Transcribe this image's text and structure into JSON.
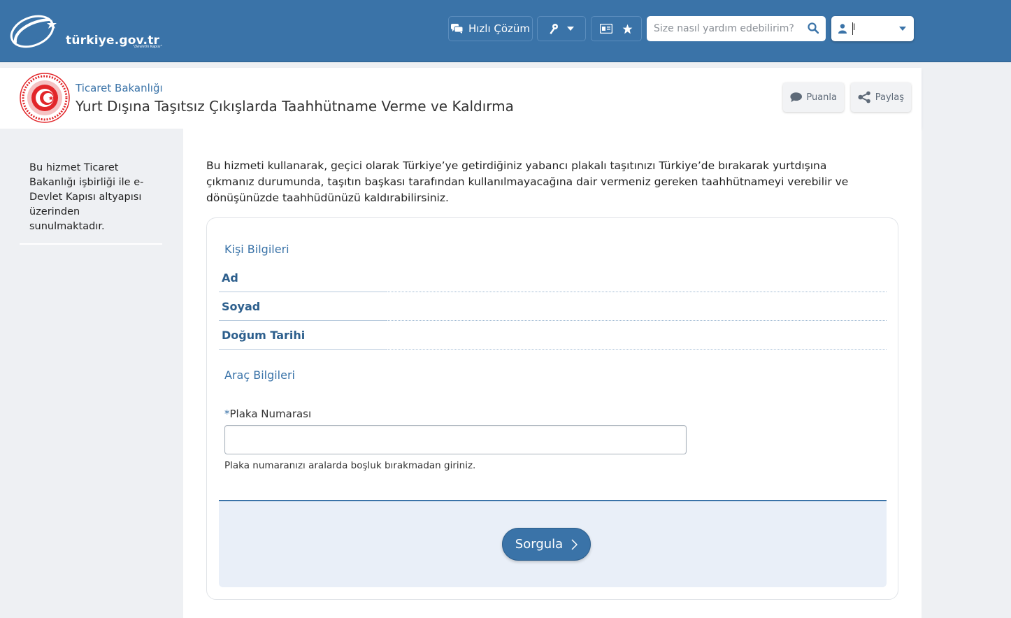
{
  "header": {
    "logo_text": "türkiye.gov.tr",
    "logo_sub": "\"Devletin Kapısı\"",
    "quick_solution_label": "Hızlı Çözüm",
    "search_placeholder": "Size nasıl yardım edebilirim?",
    "user_name": "l"
  },
  "service": {
    "ministry": "Ticaret Bakanlığı",
    "title": "Yurt Dışına Taşıtsız Çıkışlarda Taahhütname Verme ve Kaldırma",
    "rate_label": "Puanla",
    "share_label": "Paylaş"
  },
  "sidebar": {
    "info_text": "Bu hizmet Ticaret Bakanlığı işbirliği ile e-Devlet Kapısı altyapısı üzerinden sunulmaktadır."
  },
  "main": {
    "intro": "Bu hizmeti kullanarak, geçici olarak Türkiye’ye getirdiğiniz yabancı plakalı taşıtınızı Türkiye’de bırakarak yurtdışına çıkmanız durumunda, taşıtın başkası tarafından kullanılmayacağına dair vermeniz gereken taahhütnameyi verebilir ve dönüşünüzde taahhüdünüzü kaldırabilirsiniz.",
    "person_section_title": "Kişi Bilgileri",
    "person_fields": [
      "Ad",
      "Soyad",
      "Doğum Tarihi"
    ],
    "vehicle_section_title": "Araç Bilgileri",
    "plate_required_mark": "*",
    "plate_label": "Plaka Numarası",
    "plate_value": "",
    "plate_help": "Plaka numaranızı aralarda boşluk bırakmadan giriniz.",
    "submit_label": "Sorgula"
  },
  "colors": {
    "brand_blue": "#3a73a8",
    "background": "#eef0f3",
    "submit_area": "#e9eff8"
  }
}
